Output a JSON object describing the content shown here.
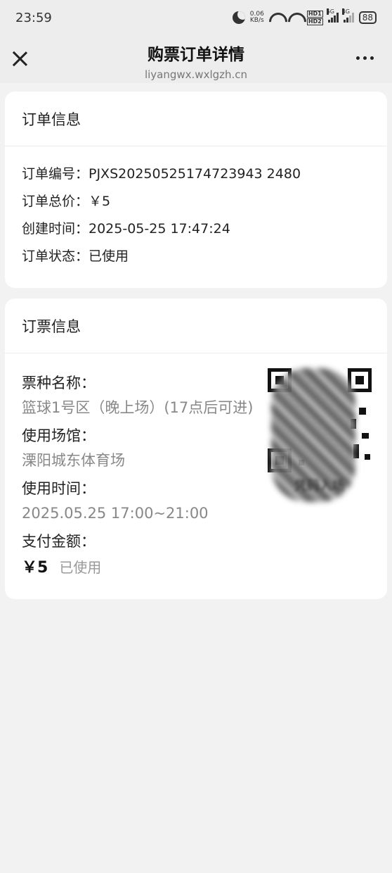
{
  "status_bar": {
    "time": "23:59",
    "net_speed_value": "0.06",
    "net_speed_unit": "KB/s",
    "hd1": "HD1",
    "hd2": "HD2",
    "sig1": "5G",
    "sig2": "4G",
    "battery": "88"
  },
  "header": {
    "title": "购票订单详情",
    "subtitle": "liyangwx.wxlgzh.cn"
  },
  "order_info": {
    "heading": "订单信息",
    "rows": [
      "订单编号：PJXS20250525174723943 2480",
      "订单总价：￥5",
      "创建时间：2025-05-25 17:47:24",
      "订单状态：已使用"
    ]
  },
  "ticket_info": {
    "heading": "订票信息",
    "type_label": "票种名称：",
    "type_value": "篮球1号区（晚上场）(17点后可进)",
    "venue_label": "使用场馆：",
    "venue_value": "溧阳城东体育场",
    "time_label": "使用时间：",
    "time_value": "2025.05.25 17:00~21:00",
    "amount_label": "支付金额：",
    "amount_value": "￥5",
    "status_value": "已使用",
    "qr_caption": "凭码入场"
  }
}
